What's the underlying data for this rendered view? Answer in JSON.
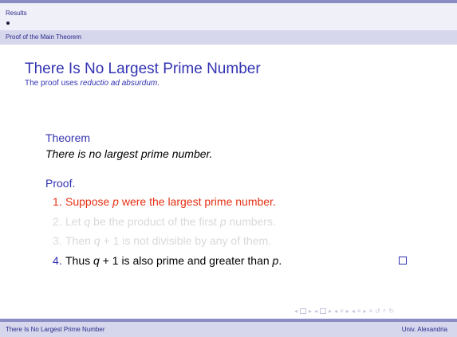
{
  "header": {
    "section": "Results",
    "subsection": "Proof of the Main Theorem"
  },
  "frame": {
    "title": "There Is No Largest Prime Number",
    "subtitle_prefix": "The proof uses ",
    "subtitle_em": "reductio ad absurdum",
    "subtitle_suffix": "."
  },
  "theorem": {
    "heading": "Theorem",
    "statement": "There is no largest prime number."
  },
  "proof": {
    "heading": "Proof.",
    "steps": [
      {
        "num": "1.",
        "a": "Suppose ",
        "v1": "p",
        "b": " were the largest prime number."
      },
      {
        "num": "2.",
        "a": "Let ",
        "v1": "q",
        "b": " be the product of the first ",
        "v2": "p",
        "c": " numbers."
      },
      {
        "num": "3.",
        "a": "Then ",
        "v1": "q",
        "b": " + 1 is not divisible by any of them."
      },
      {
        "num": "4.",
        "a": "Thus ",
        "v1": "q",
        "b": " + 1 is also prime and greater than ",
        "v2": "p",
        "c": "."
      }
    ]
  },
  "footer": {
    "left": "There Is No Largest Prime Number",
    "right": "Univ. Alexandria"
  },
  "colors": {
    "structure": "#3333b3",
    "alert": "#e53013",
    "covered": "#d9d9d9",
    "band": "#d6d6ec"
  }
}
